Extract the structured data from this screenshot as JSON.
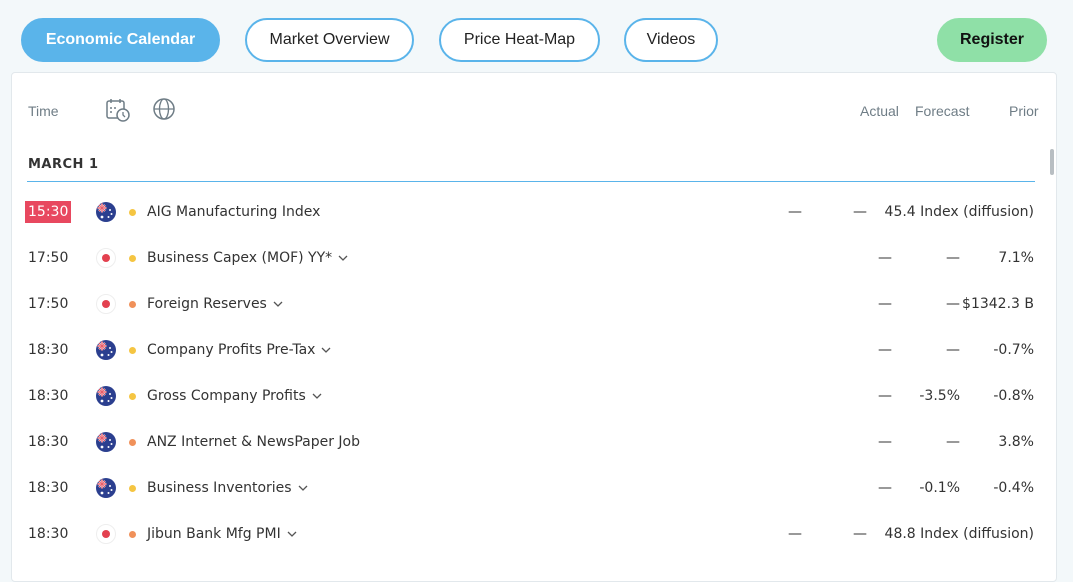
{
  "tabs": [
    {
      "label": "Economic Calendar",
      "active": true
    },
    {
      "label": "Market Overview",
      "active": false
    },
    {
      "label": "Price Heat-Map",
      "active": false
    },
    {
      "label": "Videos",
      "active": false
    }
  ],
  "register_label": "Register",
  "header": {
    "time": "Time",
    "actual": "Actual",
    "forecast": "Forecast",
    "prior": "Prior",
    "icons": [
      "calendar-clock-icon",
      "globe-icon"
    ]
  },
  "section": {
    "title": "MARCH 1"
  },
  "colors": {
    "accent": "#5ab4ea",
    "register": "#8fe0a7",
    "time_highlight": "#e8485f",
    "dot_yellow": "#f5c542",
    "dot_orange": "#f0915a",
    "japan_red": "#e3414f",
    "au_blue": "#2b3f8f"
  },
  "events": [
    {
      "time": "15:30",
      "highlight": true,
      "flag": "australia",
      "impact": "yellow",
      "name": "AIG Manufacturing Index",
      "chevron": false,
      "actual": "—",
      "forecast": "—",
      "prior": "45.4 Index (diffusion)"
    },
    {
      "time": "17:50",
      "highlight": false,
      "flag": "japan",
      "impact": "yellow",
      "name": "Business Capex (MOF) YY*",
      "chevron": true,
      "actual": "—",
      "forecast": "—",
      "prior": "7.1%"
    },
    {
      "time": "17:50",
      "highlight": false,
      "flag": "japan",
      "impact": "orange",
      "name": "Foreign Reserves",
      "chevron": true,
      "actual": "—",
      "forecast": "—",
      "prior": "$1342.3 B"
    },
    {
      "time": "18:30",
      "highlight": false,
      "flag": "australia",
      "impact": "yellow",
      "name": "Company Profits Pre-Tax",
      "chevron": true,
      "actual": "—",
      "forecast": "—",
      "prior": "-0.7%"
    },
    {
      "time": "18:30",
      "highlight": false,
      "flag": "australia",
      "impact": "yellow",
      "name": "Gross Company Profits",
      "chevron": true,
      "actual": "—",
      "forecast": "-3.5%",
      "prior": "-0.8%"
    },
    {
      "time": "18:30",
      "highlight": false,
      "flag": "australia",
      "impact": "orange",
      "name": "ANZ Internet & NewsPaper Job",
      "chevron": false,
      "actual": "—",
      "forecast": "—",
      "prior": "3.8%"
    },
    {
      "time": "18:30",
      "highlight": false,
      "flag": "australia",
      "impact": "yellow",
      "name": "Business Inventories",
      "chevron": true,
      "actual": "—",
      "forecast": "-0.1%",
      "prior": "-0.4%"
    },
    {
      "time": "18:30",
      "highlight": false,
      "flag": "japan",
      "impact": "orange",
      "name": "Jibun Bank Mfg PMI",
      "chevron": true,
      "actual": "—",
      "forecast": "—",
      "prior": "48.8 Index (diffusion)"
    }
  ]
}
